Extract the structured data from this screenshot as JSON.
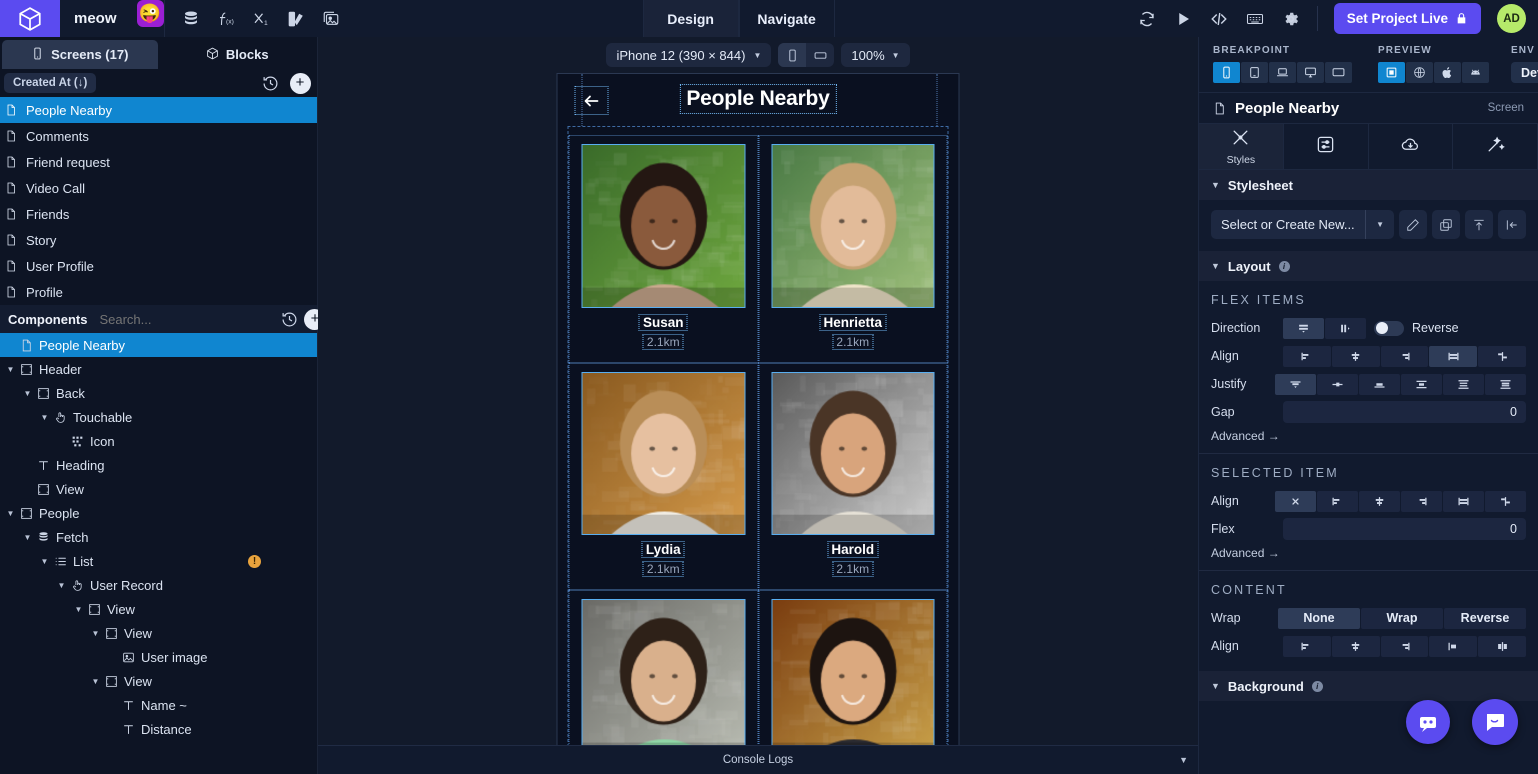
{
  "topbar": {
    "project_name": "meow",
    "emoji": "😜",
    "tools": [
      "database-icon",
      "function-icon",
      "variable-icon",
      "theme-icon",
      "media-icon"
    ],
    "tabs": [
      {
        "label": "Design",
        "active": true
      },
      {
        "label": "Navigate",
        "active": false
      }
    ],
    "right_icons": [
      "refresh-icon",
      "play-icon",
      "code-icon",
      "keyboard-icon",
      "gear-icon"
    ],
    "live_button": "Set Project Live",
    "avatar": "AD"
  },
  "sidebar": {
    "tabs": [
      {
        "label": "Screens (17)",
        "active": true,
        "icon": "phone-icon"
      },
      {
        "label": "Blocks",
        "active": false,
        "icon": "cube-icon"
      }
    ],
    "sort_chip": "Created At (↓)",
    "history_icon": "history-icon",
    "add_icon": "plus-icon",
    "screens": [
      {
        "label": "People Nearby",
        "selected": true
      },
      {
        "label": "Comments",
        "selected": false
      },
      {
        "label": "Friend request",
        "selected": false
      },
      {
        "label": "Video Call",
        "selected": false
      },
      {
        "label": "Friends",
        "selected": false
      },
      {
        "label": "Story",
        "selected": false
      },
      {
        "label": "User Profile",
        "selected": false
      },
      {
        "label": "Profile",
        "selected": false
      }
    ],
    "components_header": {
      "title": "Components",
      "search_placeholder": "Search..."
    },
    "tree": [
      {
        "label": "People Nearby",
        "depth": 0,
        "icon": "doc-icon",
        "caret": "",
        "selected": true,
        "warn": false
      },
      {
        "label": "Header",
        "depth": 0,
        "icon": "view-icon",
        "caret": "down",
        "selected": false,
        "warn": false
      },
      {
        "label": "Back",
        "depth": 1,
        "icon": "view-icon",
        "caret": "down",
        "selected": false,
        "warn": false
      },
      {
        "label": "Touchable",
        "depth": 2,
        "icon": "touch-icon",
        "caret": "down",
        "selected": false,
        "warn": false
      },
      {
        "label": "Icon",
        "depth": 3,
        "icon": "glyph-icon",
        "caret": "",
        "selected": false,
        "warn": false
      },
      {
        "label": "Heading",
        "depth": 1,
        "icon": "text-icon",
        "caret": "",
        "selected": false,
        "warn": false
      },
      {
        "label": "View",
        "depth": 1,
        "icon": "view-icon",
        "caret": "",
        "selected": false,
        "warn": false
      },
      {
        "label": "People",
        "depth": 0,
        "icon": "view-icon",
        "caret": "down",
        "selected": false,
        "warn": false
      },
      {
        "label": "Fetch",
        "depth": 1,
        "icon": "db-icon",
        "caret": "down",
        "selected": false,
        "warn": false
      },
      {
        "label": "List",
        "depth": 2,
        "icon": "list-icon",
        "caret": "down",
        "selected": false,
        "warn": true
      },
      {
        "label": "User Record",
        "depth": 3,
        "icon": "touch-icon",
        "caret": "down",
        "selected": false,
        "warn": false
      },
      {
        "label": "View",
        "depth": 4,
        "icon": "view-icon",
        "caret": "down",
        "selected": false,
        "warn": false
      },
      {
        "label": "View",
        "depth": 5,
        "icon": "view-icon",
        "caret": "down",
        "selected": false,
        "warn": false
      },
      {
        "label": "User image",
        "depth": 6,
        "icon": "image-icon",
        "caret": "",
        "selected": false,
        "warn": false
      },
      {
        "label": "View",
        "depth": 5,
        "icon": "view-icon",
        "caret": "down",
        "selected": false,
        "warn": false
      },
      {
        "label": "Name ~",
        "depth": 6,
        "icon": "text-icon",
        "caret": "",
        "selected": false,
        "warn": false
      },
      {
        "label": "Distance",
        "depth": 6,
        "icon": "text-icon",
        "caret": "",
        "selected": false,
        "warn": false
      }
    ]
  },
  "canvas": {
    "device": "iPhone 12 (390 × 844)",
    "orientation": [
      {
        "icon": "portrait-icon",
        "active": true
      },
      {
        "icon": "landscape-icon",
        "active": false
      }
    ],
    "zoom": "100%",
    "preview": {
      "title": "People Nearby",
      "back_icon": "arrow-left-icon",
      "people": [
        {
          "name": "Susan",
          "distance": "2.1km"
        },
        {
          "name": "Henrietta",
          "distance": "2.1km"
        },
        {
          "name": "Lydia",
          "distance": "2.1km"
        },
        {
          "name": "Harold",
          "distance": "2.1km"
        },
        {
          "name": "",
          "distance": ""
        },
        {
          "name": "",
          "distance": ""
        }
      ]
    },
    "console_label": "Console Logs"
  },
  "right_panel": {
    "breakpoint": {
      "caption": "BREAKPOINT",
      "options": [
        {
          "icon": "phone-icon",
          "active": true
        },
        {
          "icon": "tablet-icon",
          "active": false
        },
        {
          "icon": "laptop-icon",
          "active": false
        },
        {
          "icon": "desktop-icon",
          "active": false
        },
        {
          "icon": "tv-icon",
          "active": false
        }
      ]
    },
    "preview": {
      "caption": "PREVIEW",
      "options": [
        {
          "icon": "canvas-icon",
          "active": true
        },
        {
          "icon": "globe-icon",
          "active": false
        },
        {
          "icon": "apple-icon",
          "active": false
        },
        {
          "icon": "android-icon",
          "active": false
        }
      ]
    },
    "env": {
      "caption": "ENV",
      "value": "Dev"
    },
    "screen_header": {
      "name": "People Nearby",
      "type": "Screen"
    },
    "tabs": [
      {
        "label": "Styles",
        "icon": "brush-icon",
        "active": true
      },
      {
        "label": "",
        "icon": "sliders-icon",
        "active": false
      },
      {
        "label": "",
        "icon": "cloud-download-icon",
        "active": false
      },
      {
        "label": "",
        "icon": "magic-wand-icon",
        "active": false
      }
    ],
    "stylesheet": {
      "title": "Stylesheet",
      "select_label": "Select or Create New...",
      "actions": [
        "pencil-icon",
        "duplicate-icon",
        "upload-icon",
        "collapse-icon"
      ]
    },
    "layout": {
      "title": "Layout",
      "flex_items": {
        "group_title": "FLEX ITEMS",
        "direction_label": "Direction",
        "direction_options": [
          {
            "icon": "column-icon",
            "active": true
          },
          {
            "icon": "row-icon",
            "active": false
          }
        ],
        "reverse_label": "Reverse",
        "reverse_on": false,
        "align_label": "Align",
        "align_options": [
          {
            "icon": "align-start-icon",
            "active": false
          },
          {
            "icon": "align-center-icon",
            "active": false
          },
          {
            "icon": "align-end-icon",
            "active": false
          },
          {
            "icon": "align-stretch-icon",
            "active": true
          },
          {
            "icon": "align-baseline-icon",
            "active": false
          }
        ],
        "justify_label": "Justify",
        "justify_options": [
          {
            "icon": "justify-start-icon",
            "active": true
          },
          {
            "icon": "justify-center-icon",
            "active": false
          },
          {
            "icon": "justify-end-icon",
            "active": false
          },
          {
            "icon": "justify-between-icon",
            "active": false
          },
          {
            "icon": "justify-around-icon",
            "active": false
          },
          {
            "icon": "justify-evenly-icon",
            "active": false
          }
        ],
        "gap_label": "Gap",
        "gap_value": "0",
        "advanced_label": "Advanced →"
      },
      "selected_item": {
        "group_title": "SELECTED ITEM",
        "align_label": "Align",
        "align_options": [
          {
            "icon": "none-icon",
            "active": true
          },
          {
            "icon": "align-start-icon",
            "active": false
          },
          {
            "icon": "align-center-icon",
            "active": false
          },
          {
            "icon": "align-end-icon",
            "active": false
          },
          {
            "icon": "align-stretch-icon",
            "active": false
          },
          {
            "icon": "align-baseline-icon",
            "active": false
          }
        ],
        "flex_label": "Flex",
        "flex_value": "0",
        "advanced_label": "Advanced →"
      },
      "content": {
        "group_title": "CONTENT",
        "wrap_label": "Wrap",
        "wrap_options": [
          {
            "label": "None",
            "active": true
          },
          {
            "label": "Wrap",
            "active": false
          },
          {
            "label": "Reverse",
            "active": false
          }
        ],
        "align_label": "Align",
        "align_options": [
          {
            "icon": "align-start-icon",
            "active": false
          },
          {
            "icon": "align-center-icon",
            "active": false
          },
          {
            "icon": "align-end-icon",
            "active": false
          },
          {
            "icon": "align-between-icon",
            "active": false
          },
          {
            "icon": "align-around-icon",
            "active": false
          }
        ]
      }
    },
    "background": {
      "title": "Background"
    }
  },
  "fabs": [
    {
      "icon": "chatbot-icon"
    },
    {
      "icon": "chat-bubble-icon"
    }
  ],
  "colors": {
    "accent_purple": "#5b4bf0",
    "accent_blue": "#1086d0",
    "panel_bg": "#111a2e",
    "canvas_bg": "#121a2b",
    "warn": "#e8a33d",
    "avatar_bg": "#b6ea6a"
  }
}
